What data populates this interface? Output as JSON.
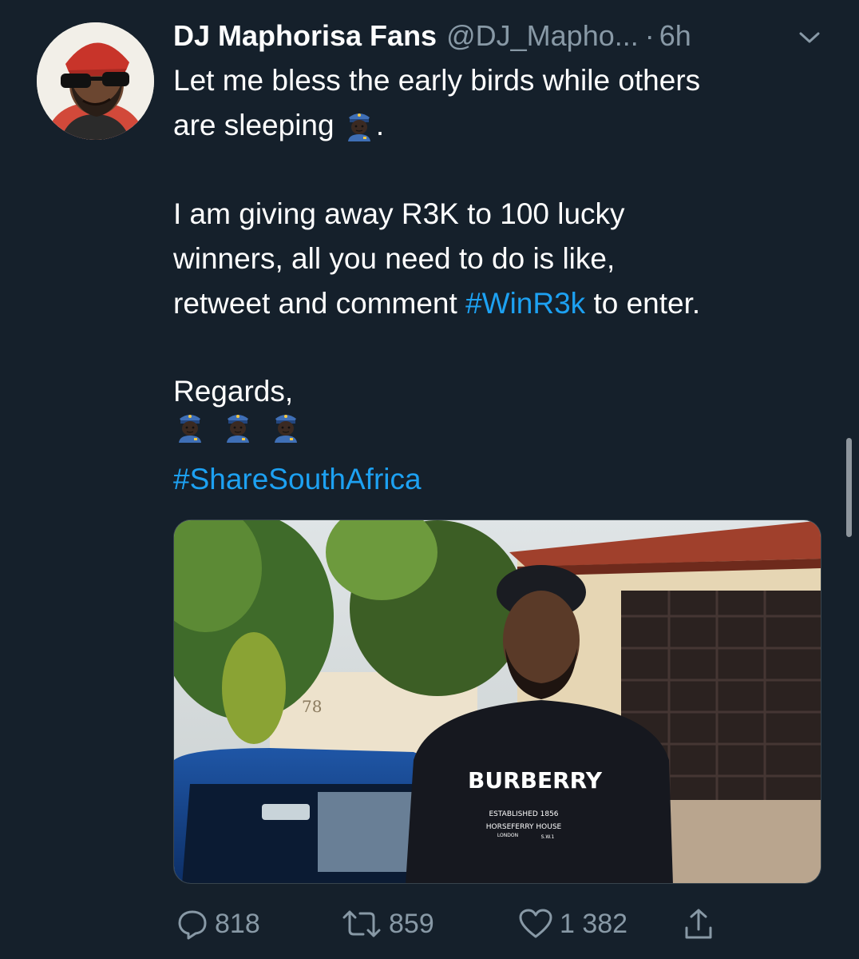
{
  "tweet": {
    "display_name": "DJ Maphorisa Fans",
    "handle": "@DJ_Mapho...",
    "separator": "·",
    "time": "6h",
    "text": {
      "line1": "Let me bless the early birds while others",
      "line2_prefix": "are sleeping",
      "line2_suffix": ".",
      "line3": "I am giving away R3K to 100 lucky",
      "line4": "winners, all you need to do is like,",
      "line5_prefix": "retweet and comment",
      "line5_hashtag": "#WinR3k",
      "line5_suffix": "to enter.",
      "line6": "Regards,",
      "line7_hashtag": "#ShareSouthAfrica"
    },
    "emoji": "police-officer-emoji",
    "media": {
      "sweater_brand": "BURBERRY",
      "sweater_line1": "ESTABLISHED 1856",
      "sweater_line2": "HORSEFERRY HOUSE",
      "sweater_line3": "LONDON",
      "sweater_line4": "S.W.1",
      "house_number": "78"
    },
    "actions": {
      "replies": "818",
      "retweets": "859",
      "likes": "1 382"
    }
  },
  "colors": {
    "background": "#15202b",
    "text": "#ffffff",
    "secondary": "#8899a6",
    "link": "#1da1f2"
  },
  "icons": [
    "reply-icon",
    "retweet-icon",
    "like-icon",
    "share-icon",
    "chevron-down-icon"
  ]
}
